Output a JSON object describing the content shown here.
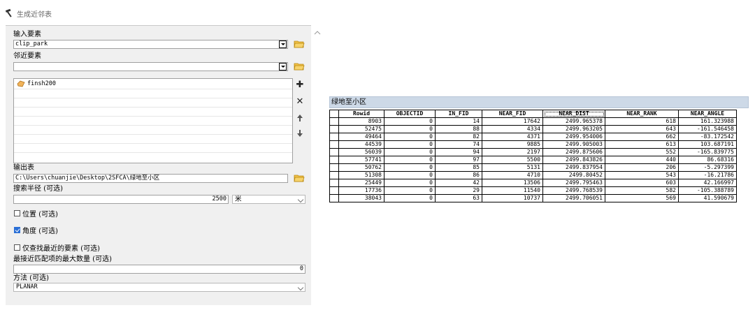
{
  "tool": {
    "title": "生成近邻表"
  },
  "form": {
    "input_features": {
      "label": "输入要素",
      "value": "clip_park"
    },
    "near_features": {
      "label": "邻近要素",
      "value": "",
      "items": [
        "finsh200"
      ]
    },
    "output_table": {
      "label": "输出表",
      "value": "C:\\Users\\chuanjie\\Desktop\\2SFCA\\绿地至小区"
    },
    "search_radius": {
      "label": "搜索半径 (可选)",
      "value": "2500",
      "unit": "米"
    },
    "location": {
      "label": "位置 (可选)",
      "checked": false
    },
    "angle": {
      "label": "角度 (可选)",
      "checked": true
    },
    "closest_only": {
      "label": "仅查找最近的要素 (可选)",
      "checked": false
    },
    "max_matches": {
      "label": "最接近匹配项的最大数量 (可选)",
      "value": "0"
    },
    "method": {
      "label": "方法 (可选)",
      "value": "PLANAR"
    }
  },
  "table": {
    "title": "绿地至小区",
    "columns": [
      "Rowid",
      "OBJECTID",
      "IN_FID",
      "NEAR_FID",
      "NEAR_DIST",
      "NEAR_RANK",
      "NEAR_ANGLE"
    ],
    "rows": [
      [
        "8903",
        "0",
        "14",
        "17642",
        "2499.965378",
        "618",
        "161.323988"
      ],
      [
        "52475",
        "0",
        "88",
        "4334",
        "2499.963205",
        "643",
        "-161.546458"
      ],
      [
        "49464",
        "0",
        "82",
        "4371",
        "2499.954006",
        "662",
        "-83.172542"
      ],
      [
        "44539",
        "0",
        "74",
        "9885",
        "2499.905003",
        "613",
        "103.687191"
      ],
      [
        "56039",
        "0",
        "94",
        "2197",
        "2499.875606",
        "552",
        "-165.839775"
      ],
      [
        "57741",
        "0",
        "97",
        "5500",
        "2499.843826",
        "440",
        "86.68316"
      ],
      [
        "50762",
        "0",
        "85",
        "5131",
        "2499.837954",
        "206",
        "-5.297399"
      ],
      [
        "51308",
        "0",
        "86",
        "4710",
        "2499.80452",
        "543",
        "-16.21786"
      ],
      [
        "25449",
        "0",
        "42",
        "13506",
        "2499.795463",
        "603",
        "42.166997"
      ],
      [
        "17736",
        "0",
        "29",
        "11540",
        "2499.768539",
        "582",
        "-105.388789"
      ],
      [
        "38043",
        "0",
        "63",
        "10737",
        "2499.706051",
        "569",
        "41.590679"
      ]
    ]
  }
}
